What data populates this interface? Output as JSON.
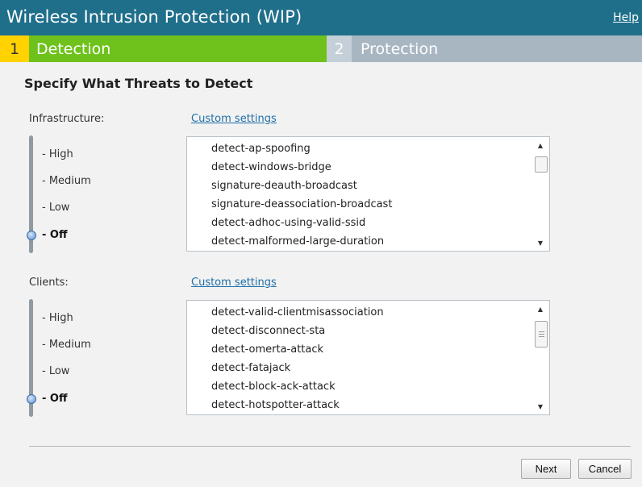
{
  "header": {
    "title": "Wireless Intrusion Protection (WIP)",
    "help": "Help"
  },
  "steps": [
    {
      "num": "1",
      "label": "Detection",
      "active": true
    },
    {
      "num": "2",
      "label": "Protection",
      "active": false
    }
  ],
  "heading": "Specify What Threats to Detect",
  "infrastructure": {
    "label": "Infrastructure:",
    "custom_link": "Custom settings",
    "levels": [
      "- High",
      "- Medium",
      "- Low",
      "- Off"
    ],
    "selected_level": "- Off",
    "items": [
      "detect-ap-spoofing",
      "detect-windows-bridge",
      "signature-deauth-broadcast",
      "signature-deassociation-broadcast",
      "detect-adhoc-using-valid-ssid",
      "detect-malformed-large-duration"
    ]
  },
  "clients": {
    "label": "Clients:",
    "custom_link": "Custom settings",
    "levels": [
      "- High",
      "- Medium",
      "- Low",
      "- Off"
    ],
    "selected_level": "- Off",
    "items": [
      "detect-valid-clientmisassociation",
      "detect-disconnect-sta",
      "detect-omerta-attack",
      "detect-fatajack",
      "detect-block-ack-attack",
      "detect-hotspotter-attack"
    ]
  },
  "buttons": {
    "next": "Next",
    "cancel": "Cancel"
  },
  "colors": {
    "title_bar": "#1f6f8b",
    "step_active": "#6ec21b",
    "step_active_number": "#ffd200",
    "step_inactive": "#a8b6c2",
    "link": "#1f6fa8"
  }
}
